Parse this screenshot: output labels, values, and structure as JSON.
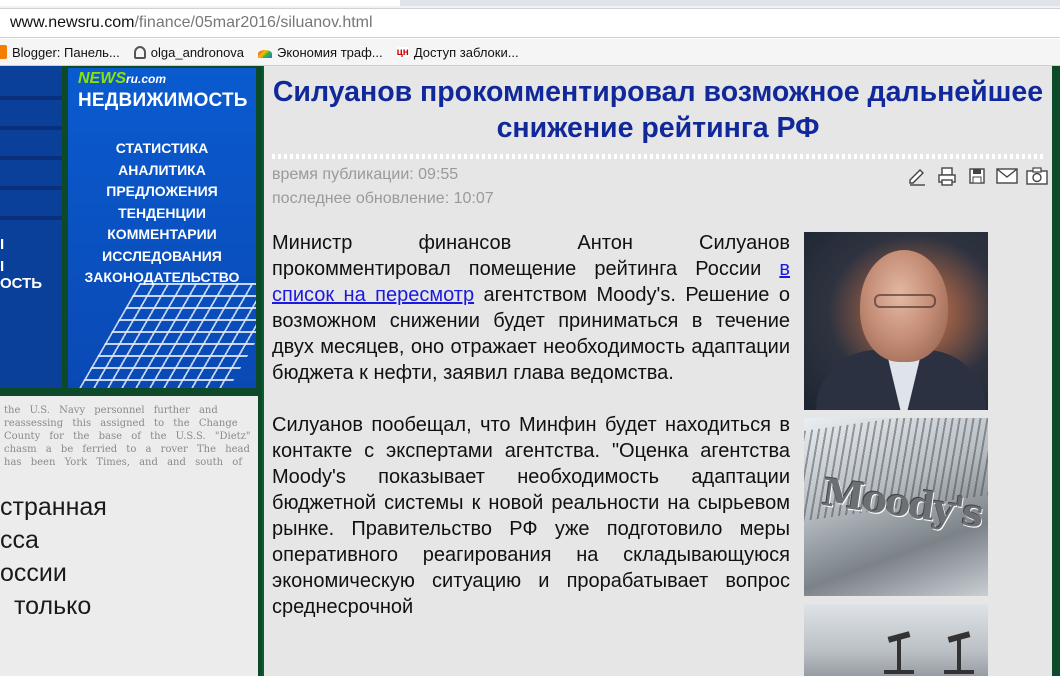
{
  "browser": {
    "url_host": "www.newsru.com",
    "url_path": "/finance/05mar2016/siluanov.html"
  },
  "bookmarks": [
    {
      "label": "Blogger: Панель...",
      "icon": "blogger-icon"
    },
    {
      "label": "olga_andronova",
      "icon": "user-icon"
    },
    {
      "label": "Экономия траф...",
      "icon": "rainbow-icon"
    },
    {
      "label": "Доступ заблоки...",
      "icon": "cn-icon",
      "icon_text": "цн"
    }
  ],
  "left_banner": {
    "logo_news": "NEWS",
    "logo_ru": "ru.com",
    "brand": "НЕДВИЖИМОСТЬ",
    "items": [
      "СТАТИСТИКА",
      "АНАЛИТИКА",
      "ПРЕДЛОЖЕНИЯ",
      "ТЕНДЕНЦИИ",
      "КОММЕНТАРИИ",
      "ИССЛЕДОВАНИЯ",
      "ЗАКОНОДАТЕЛЬСТВО"
    ],
    "strip_fragments": [
      "",
      "",
      "I",
      "I",
      "ОСТЬ"
    ]
  },
  "news_clip": {
    "fine_text": "the U.S. Navy personnel further and reassessing this assigned to the Change County for the base of the U.S.S. \"Dietz\" chasm a be ferried to a rover The head has been York Times, and and south of",
    "big_lines": [
      "странная",
      "сса",
      "оссии",
      "только"
    ]
  },
  "article": {
    "headline": "Силуанов прокомментировал возможное дальнейшее снижение рейтинга РФ",
    "published": "время публикации: 09:55",
    "updated": "последнее обновление: 10:07",
    "p1_before": "Министр финансов Антон Силуанов прокомментировал помещение рейтинга России ",
    "p1_link": "в список на пересмотр",
    "p1_after": " агентством Moody's. Решение о возможном снижении будет приниматься в течение двух месяцев, оно отражает необходимость адаптации бюджета к нефти, заявил глава ведомства.",
    "p2": "Силуанов пообещал, что Минфин будет находиться в контакте с экспертами агентства. \"Оценка агентства Moody's показывает необходимость адаптации бюджетной системы к новой реальности на сырьевом рынке. Правительство РФ уже подготовило меры оперативного реагирования на складывающуюся экономическую ситуацию и прорабатывает вопрос среднесрочной",
    "photo2_sign": "Moody's"
  },
  "tools": [
    "edit-icon",
    "print-icon",
    "save-icon",
    "mail-icon",
    "camera-icon"
  ],
  "colors": {
    "headline": "#10289a",
    "link": "#1a1adf",
    "page_bg": "#0c5a2e",
    "banner_blue": "#0a5bd0",
    "logo_green": "#8fe300"
  }
}
